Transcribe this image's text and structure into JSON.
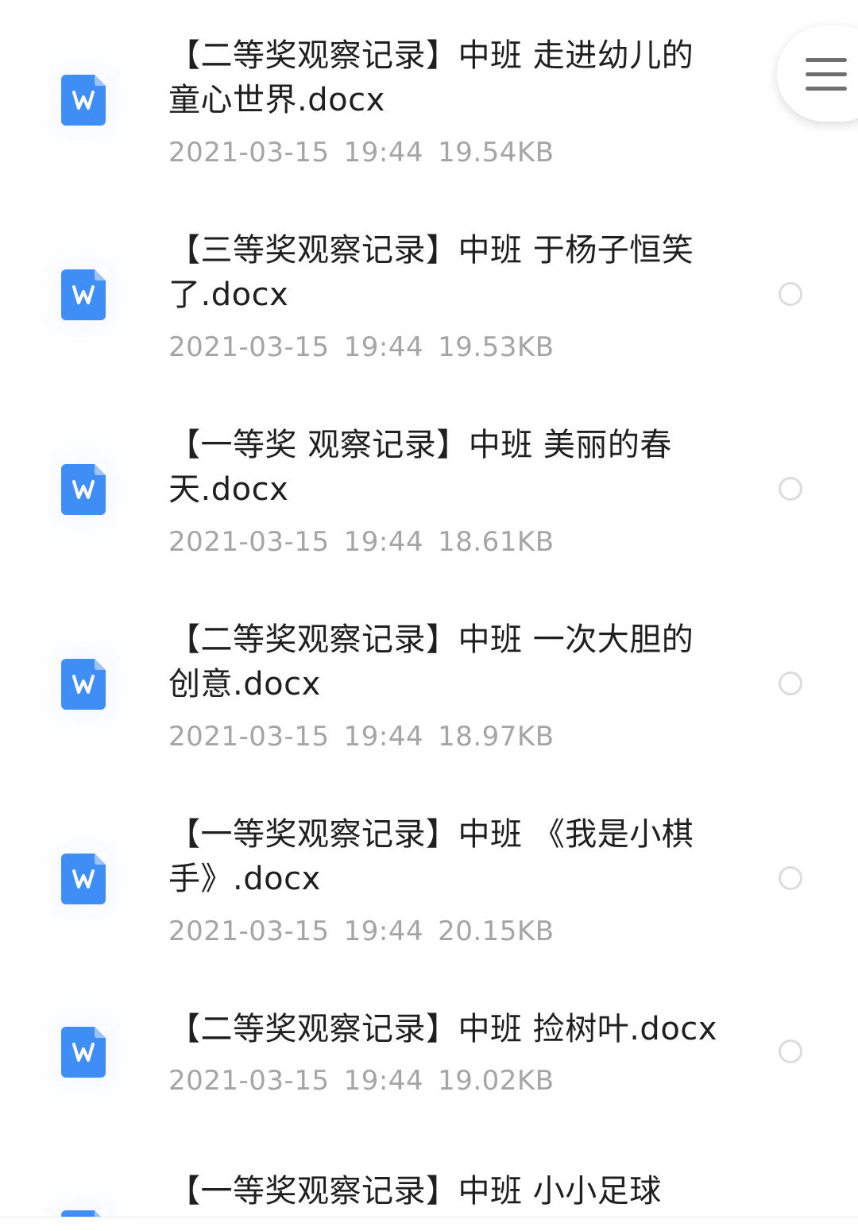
{
  "files": [
    {
      "name": "【二等奖观察记录】中班 走进幼儿的童心世界.docx",
      "date": "2021-03-15",
      "time": "19:44",
      "size": "19.54KB",
      "icon": "word-doc-icon"
    },
    {
      "name": "【三等奖观察记录】中班 于杨子恒笑了.docx",
      "date": "2021-03-15",
      "time": "19:44",
      "size": "19.53KB",
      "icon": "word-doc-icon"
    },
    {
      "name": "【一等奖 观察记录】中班 美丽的春天.docx",
      "date": "2021-03-15",
      "time": "19:44",
      "size": "18.61KB",
      "icon": "word-doc-icon"
    },
    {
      "name": "【二等奖观察记录】中班 一次大胆的创意.docx",
      "date": "2021-03-15",
      "time": "19:44",
      "size": "18.97KB",
      "icon": "word-doc-icon"
    },
    {
      "name": "【一等奖观察记录】中班 《我是小棋手》.docx",
      "date": "2021-03-15",
      "time": "19:44",
      "size": "20.15KB",
      "icon": "word-doc-icon"
    },
    {
      "name": "【二等奖观察记录】中班 捡树叶.docx",
      "date": "2021-03-15",
      "time": "19:44",
      "size": "19.02KB",
      "icon": "word-doc-icon"
    },
    {
      "name": "【一等奖观察记录】中班 小小足球",
      "icon": "word-doc-icon"
    }
  ],
  "menu_button": {
    "icon": "hamburger-menu-icon"
  },
  "colors": {
    "doc_icon_blue": "#3f8ef5",
    "title_text": "#1f1f1f",
    "meta_text": "#a5a5a5",
    "radio_border": "#dcdcdc"
  }
}
